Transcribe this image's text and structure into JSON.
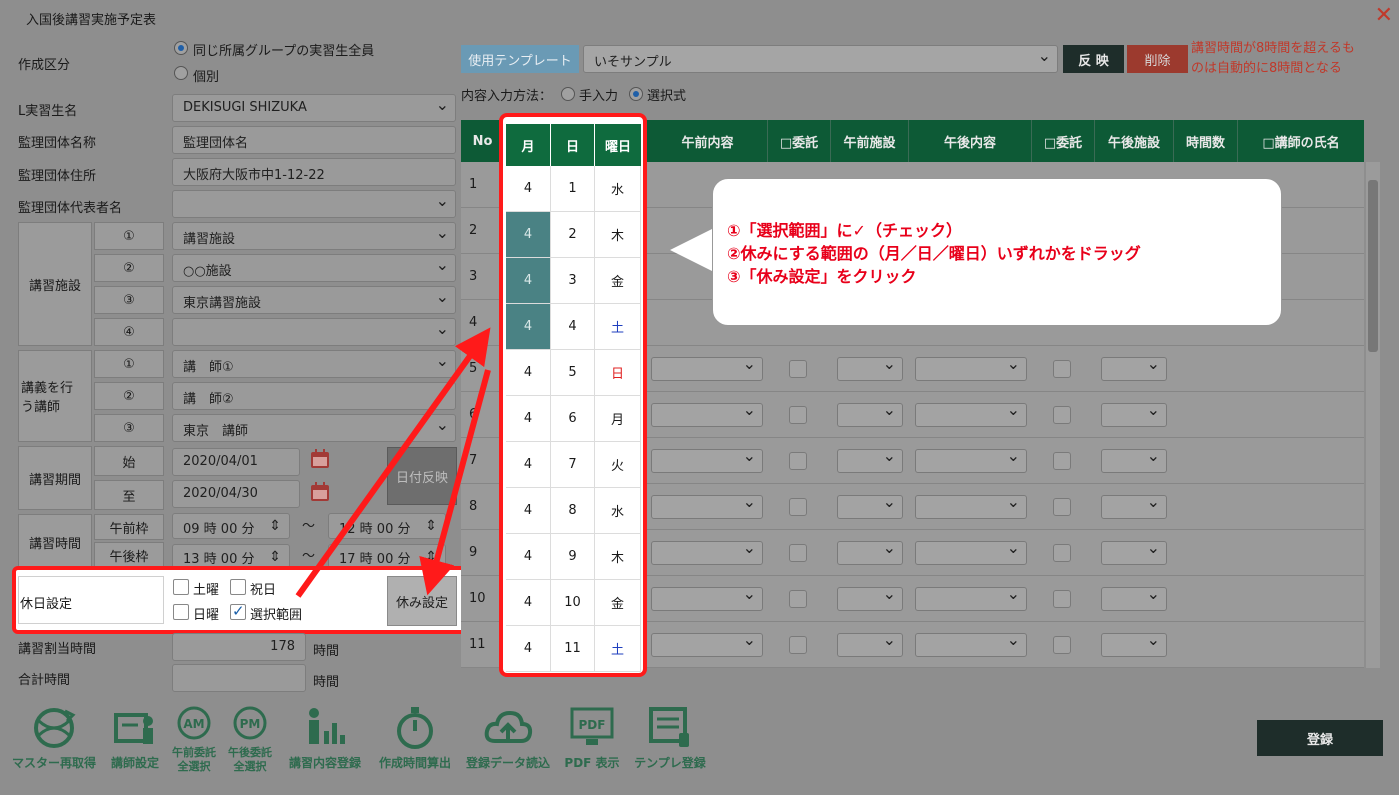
{
  "window": {
    "title": "入国後講習実施予定表",
    "close_glyph": "✕"
  },
  "form": {
    "creation_type_label": "作成区分",
    "creation_options": [
      "同じ所属グループの実習生全員",
      "個別"
    ],
    "trainee_label": "L実習生名",
    "trainee_value": "DEKISUGI SHIZUKA",
    "org_name_label": "監理団体名称",
    "org_name_value": "監理団体名",
    "org_address_label": "監理団体住所",
    "org_address_value": "大阪府大阪市中1-12-22",
    "org_rep_label": "監理団体代表者名",
    "facility_label": "講習施設",
    "facility_nums": [
      "①",
      "②",
      "③",
      "④"
    ],
    "facility_values": [
      "講習施設",
      "○○施設",
      "東京講習施設",
      ""
    ],
    "instructor_label_1": "講義を行",
    "instructor_label_2": "う講師",
    "instructor_nums": [
      "①",
      "②",
      "③"
    ],
    "instructor_values": [
      "講　師①",
      "講　師②",
      "東京　講師"
    ],
    "period_label": "講習期間",
    "period_start_label": "始",
    "period_start_value": "2020/04/01",
    "period_end_label": "至",
    "period_end_value": "2020/04/30",
    "date_apply_button": "日付反映",
    "time_label": "講習時間",
    "am_label": "午前枠",
    "am_start": "09 時 00 分",
    "am_end": "12 時 00 分",
    "pm_label": "午後枠",
    "pm_start": "13 時 00 分",
    "pm_end": "17 時 00 分",
    "tilde": "〜",
    "holiday_label": "休日設定",
    "holiday_options": {
      "saturday": "土曜",
      "national": "祝日",
      "sunday": "日曜",
      "range": "選択範囲"
    },
    "holiday_button": "休み設定",
    "allocated_label": "講習割当時間",
    "allocated_value": "178",
    "hours_unit": "時間",
    "total_label": "合計時間",
    "total_value": ""
  },
  "right": {
    "template_button": "使用テンプレート",
    "template_value": "いそサンプル",
    "apply_button": "反 映",
    "delete_button": "削除",
    "note_line1": "講習時間が8時間を超えるも",
    "note_line2": "のは自動的に8時間となる",
    "input_method_label": "内容入力方法：",
    "input_manual": "手入力",
    "input_select": "選択式"
  },
  "table": {
    "headers": {
      "no": "No",
      "month": "月",
      "day": "日",
      "weekday": "曜日",
      "am_content": "午前内容",
      "am_consign": "□委託",
      "am_facility": "午前施設",
      "pm_content": "午後内容",
      "pm_consign": "□委託",
      "pm_facility": "午後施設",
      "hours": "時間数",
      "instructor": "□講師の氏名"
    },
    "rows": [
      {
        "no": "1",
        "month": "4",
        "day": "1",
        "weekday": "水"
      },
      {
        "no": "2",
        "month": "4",
        "day": "2",
        "weekday": "木"
      },
      {
        "no": "3",
        "month": "4",
        "day": "3",
        "weekday": "金"
      },
      {
        "no": "4",
        "month": "4",
        "day": "4",
        "weekday": "土"
      },
      {
        "no": "5",
        "month": "4",
        "day": "5",
        "weekday": "日"
      },
      {
        "no": "6",
        "month": "4",
        "day": "6",
        "weekday": "月"
      },
      {
        "no": "7",
        "month": "4",
        "day": "7",
        "weekday": "火"
      },
      {
        "no": "8",
        "month": "4",
        "day": "8",
        "weekday": "水"
      },
      {
        "no": "9",
        "month": "4",
        "day": "9",
        "weekday": "木"
      },
      {
        "no": "10",
        "month": "4",
        "day": "10",
        "weekday": "金"
      },
      {
        "no": "11",
        "month": "4",
        "day": "11",
        "weekday": "土"
      }
    ],
    "selected_rows": [
      2,
      3,
      4
    ]
  },
  "callout": {
    "line1": "①「選択範囲」に✓（チェック）",
    "line2": "②休みにする範囲の（月／日／曜日）いずれかをドラッグ",
    "line3": "③「休み設定」をクリック"
  },
  "toolbar": [
    {
      "label": "マスター再取得",
      "icon": "globe-refresh-icon"
    },
    {
      "label": "講師設定",
      "icon": "instructor-icon"
    },
    {
      "label": "午前委託\n全選択",
      "icon": "am-icon"
    },
    {
      "label": "午後委託\n全選択",
      "icon": "pm-icon"
    },
    {
      "label": "講習内容登録",
      "icon": "person-chart-icon"
    },
    {
      "label": "作成時間算出",
      "icon": "stopwatch-icon"
    },
    {
      "label": "登録データ読込",
      "icon": "cloud-upload-icon"
    },
    {
      "label": "PDF 表示",
      "icon": "pdf-monitor-icon"
    },
    {
      "label": "テンプレ登録",
      "icon": "template-icon"
    }
  ],
  "register_button": "登録",
  "colors": {
    "accent_green": "#0d5a36",
    "highlight_red": "#ff1a1a",
    "selection": "#4a8284",
    "sunday_red": "#e02020",
    "saturday_blue": "#1f3fbf"
  }
}
